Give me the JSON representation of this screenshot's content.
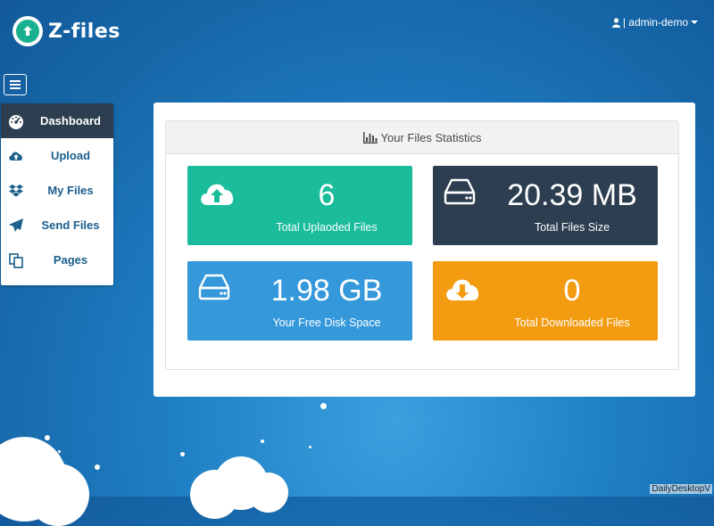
{
  "app": {
    "name": "Z-files"
  },
  "header": {
    "user_label": "| admin-demo"
  },
  "sidebar": {
    "items": [
      {
        "label": "Dashboard",
        "icon": "dashboard-icon",
        "active": true
      },
      {
        "label": "Upload",
        "icon": "cloud-upload-icon"
      },
      {
        "label": "My Files",
        "icon": "dropbox-icon"
      },
      {
        "label": "Send Files",
        "icon": "paper-plane-icon"
      },
      {
        "label": "Pages",
        "icon": "copy-icon"
      }
    ]
  },
  "stats": {
    "title": "Your Files Statistics",
    "cards": [
      {
        "value": "6",
        "label": "Total Uplaoded Files",
        "color": "#1abc9c",
        "icon": "cloud-upload-icon"
      },
      {
        "value": "20.39 MB",
        "label": "Total Files Size",
        "color": "#2c3e50",
        "icon": "hdd-icon"
      },
      {
        "value": "1.98 GB",
        "label": "Your Free Disk Space",
        "color": "#3498db",
        "icon": "hdd-icon"
      },
      {
        "value": "0",
        "label": "Total Downloaded Files",
        "color": "#f39c12",
        "icon": "cloud-download-icon"
      }
    ]
  },
  "watermark": "DailyDesktopV"
}
